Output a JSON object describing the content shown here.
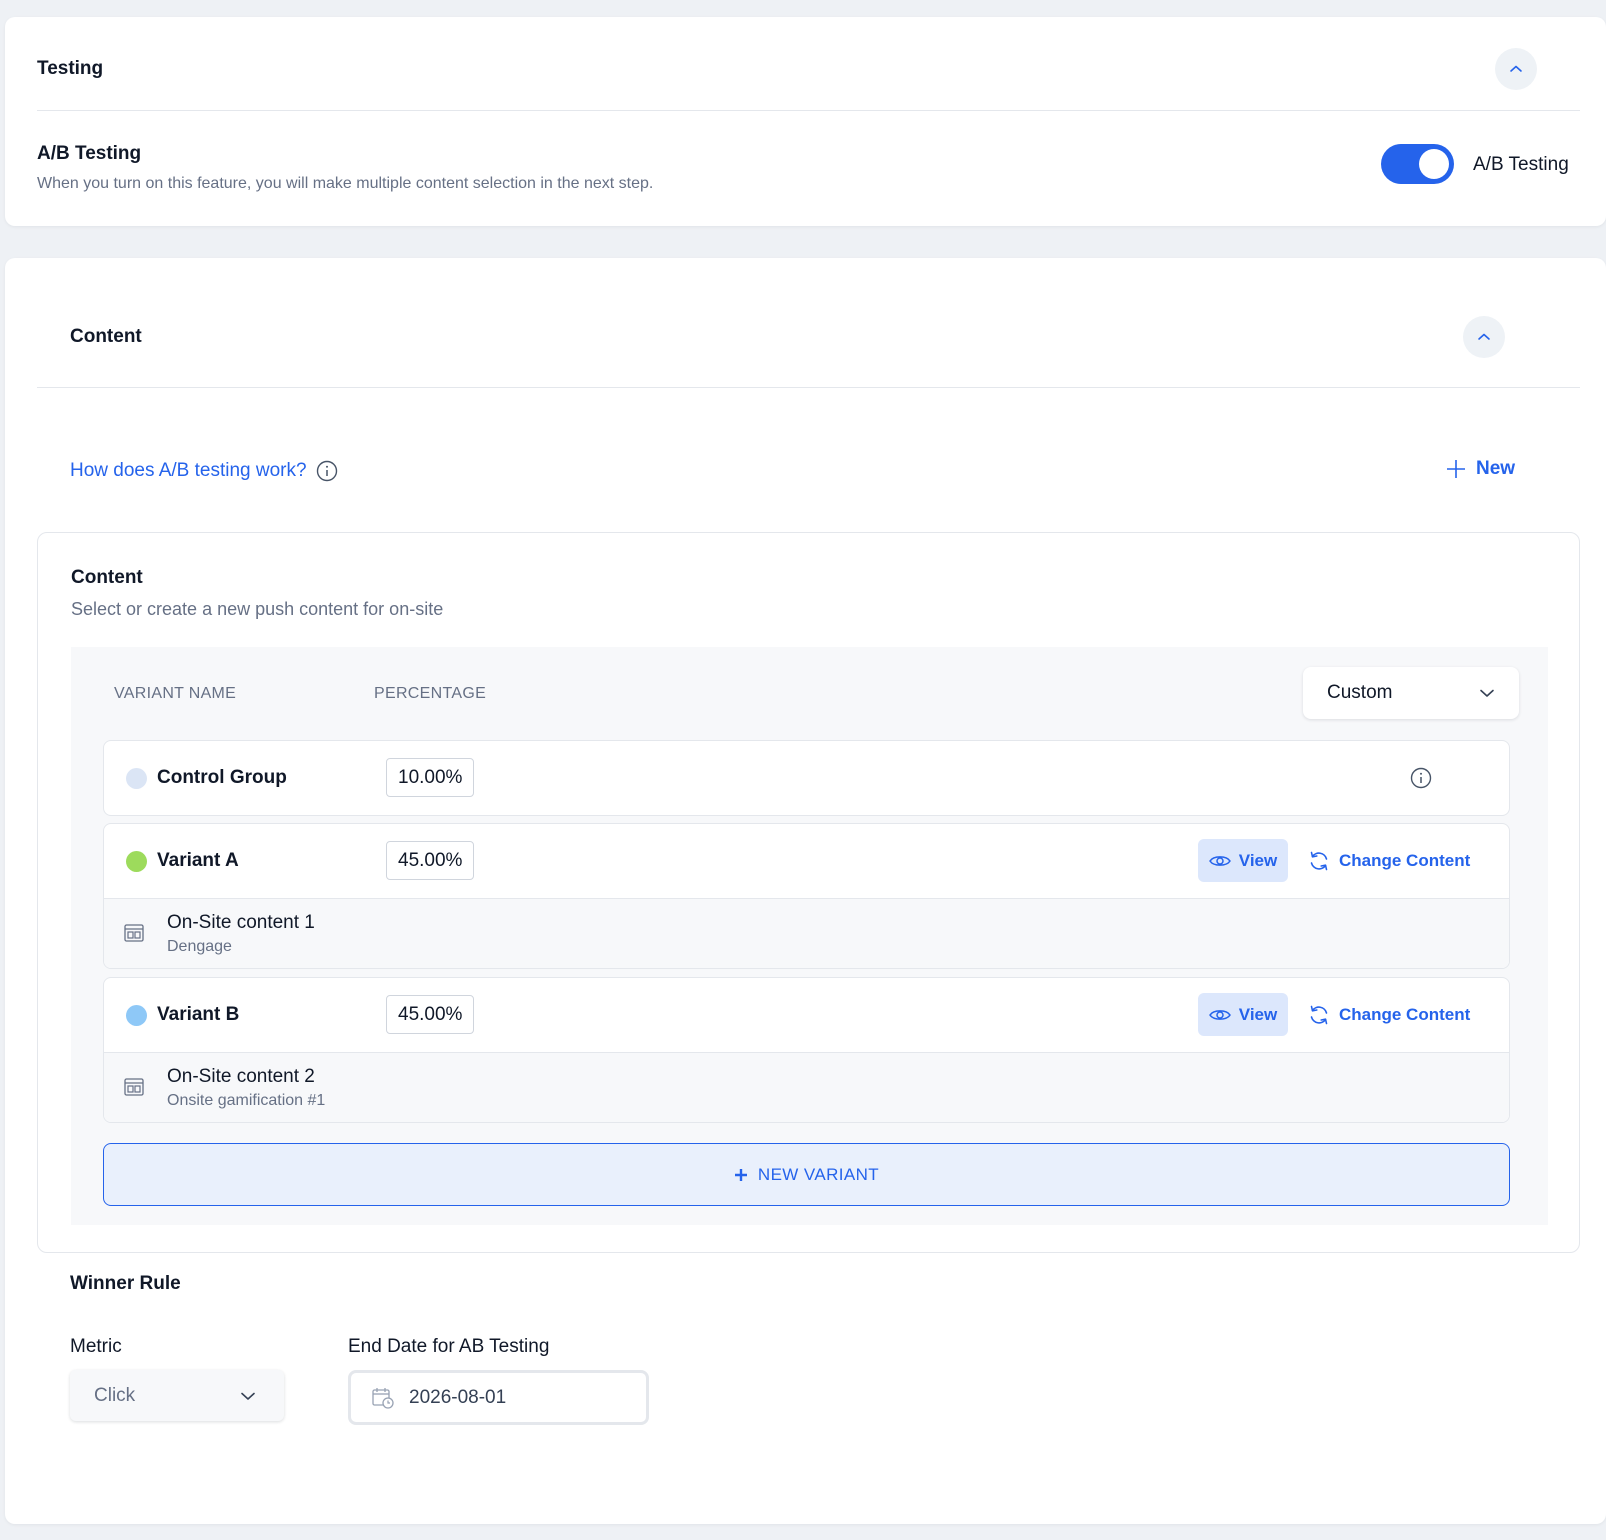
{
  "testing": {
    "title": "Testing",
    "ab_title": "A/B Testing",
    "ab_description": "When you turn on this feature, you will make multiple content selection in the next step.",
    "toggle_label": "A/B Testing",
    "toggle_on": true
  },
  "content_section": {
    "title": "Content",
    "how_link": "How does A/B testing work?",
    "new_label": "New",
    "panel_title": "Content",
    "panel_subtitle": "Select or create a new push content for on-site",
    "col_variant": "VARIANT NAME",
    "col_percentage": "PERCENTAGE",
    "distribution_select": "Custom",
    "view_label": "View",
    "change_label": "Change Content",
    "control": {
      "name": "Control Group",
      "percentage": "10.00%",
      "color": "#dbe5f5"
    },
    "variants": [
      {
        "name": "Variant A",
        "percentage": "45.00%",
        "color": "#9ddb5c",
        "content_title": "On-Site content 1",
        "content_sub": "Dengage"
      },
      {
        "name": "Variant B",
        "percentage": "45.00%",
        "color": "#8ec8f7",
        "content_title": "On-Site content 2",
        "content_sub": "Onsite gamification #1"
      }
    ],
    "new_variant_label": "NEW VARIANT"
  },
  "winner_rule": {
    "title": "Winner Rule",
    "metric_label": "Metric",
    "metric_value": "Click",
    "end_date_label": "End Date for AB Testing",
    "end_date_value": "2026-08-01"
  },
  "colors": {
    "accent": "#2563eb",
    "page_bg": "#eef1f5"
  }
}
